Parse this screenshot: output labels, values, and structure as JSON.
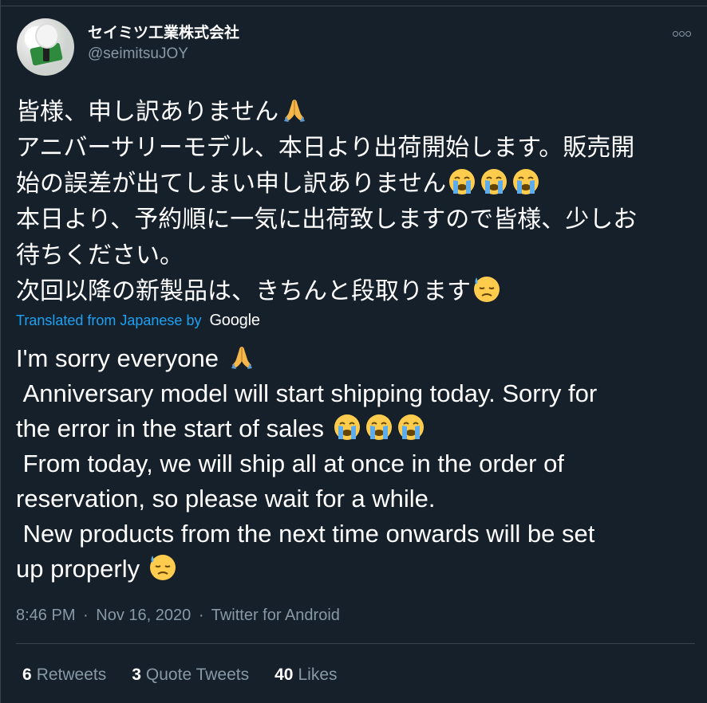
{
  "tweet": {
    "display_name": "セイミツ工業株式会社",
    "handle": "@seimitsuJOY",
    "ja_lines": [
      "皆様、申し訳ありません",
      "アニバーサリーモデル、本日より出荷開始します。販売開",
      "始の誤差が出てしまい申し訳ありません",
      "本日より、予約順に一気に出荷致しますので皆様、少しお",
      "待ちください。",
      "次回以降の新製品は、きちんと段取ります"
    ],
    "translated_label": "Translated from Japanese by",
    "translator_name": "Google",
    "en_lines": [
      "I'm sorry everyone ",
      " Anniversary model will start shipping today. Sorry for",
      "the error in the start of sales ",
      " From today, we will ship all at once in the order of",
      "reservation, so please wait for a while.",
      " New products from the next time onwards will be set",
      "up properly "
    ],
    "time": "8:46 PM",
    "date": "Nov 16, 2020",
    "source": "Twitter for Android",
    "separator": "·",
    "stats": {
      "retweets_count": "6",
      "retweets_label": "Retweets",
      "quotes_count": "3",
      "quotes_label": "Quote Tweets",
      "likes_count": "40",
      "likes_label": "Likes"
    },
    "emoji_icons": [
      "folded-hands-icon",
      "loudly-crying-face-icon",
      "downcast-face-with-sweat-icon"
    ]
  },
  "colors": {
    "background": "#15202b",
    "text": "#ffffff",
    "secondary": "#8899a6",
    "link": "#1da1f2",
    "border": "#38444d"
  }
}
